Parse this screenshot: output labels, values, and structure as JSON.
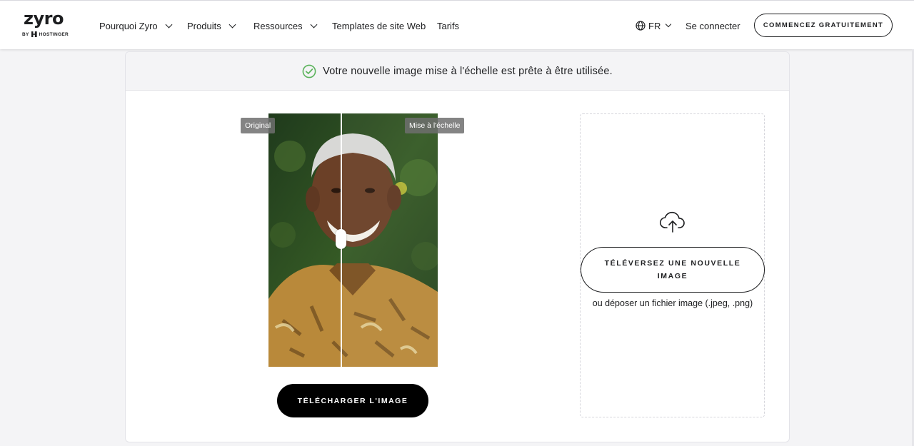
{
  "brand": {
    "name": "zyro",
    "byline": "BY",
    "partner": "HOSTINGER"
  },
  "nav": {
    "items": [
      {
        "label": "Pourquoi Zyro",
        "has_dropdown": true
      },
      {
        "label": "Produits",
        "has_dropdown": true
      },
      {
        "label": "Ressources",
        "has_dropdown": true
      },
      {
        "label": "Templates de site Web",
        "has_dropdown": false
      },
      {
        "label": "Tarifs",
        "has_dropdown": false
      }
    ],
    "language": "FR",
    "login": "Se connecter",
    "cta": "COMMENCEZ GRATUITEMENT"
  },
  "banner": {
    "message": "Votre nouvelle image mise à l'échelle est prête à être utilisée.",
    "icon": "check-circle-icon",
    "icon_color": "#5bb35b"
  },
  "compare": {
    "left_label": "Original",
    "right_label": "Mise à l'échelle",
    "slider_position": 0.43
  },
  "actions": {
    "download": "TÉLÉCHARGER L'IMAGE"
  },
  "upload": {
    "button": "TÉLÉVERSEZ UNE NOUVELLE IMAGE",
    "hint": "ou déposer un fichier image (.jpeg, .png)",
    "icon": "cloud-upload-icon"
  },
  "colors": {
    "primary": "#000000",
    "accent_success": "#5bb35b",
    "background": "#f4f4f6"
  }
}
